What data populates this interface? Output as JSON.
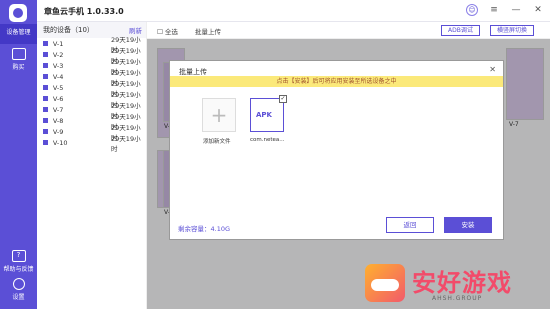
{
  "app": {
    "title": "章鱼云手机 1.0.33.0"
  },
  "nav": {
    "items": [
      {
        "label": "设备管理"
      },
      {
        "label": "购买"
      },
      {
        "label": "帮助与反馈"
      },
      {
        "label": "设置"
      }
    ]
  },
  "sidebar": {
    "title": "我的设备（10）",
    "refresh": "刷新",
    "devices": [
      {
        "name": "V-1",
        "time": "29天19小时"
      },
      {
        "name": "V-2",
        "time": "29天19小时"
      },
      {
        "name": "V-3",
        "time": "29天19小时"
      },
      {
        "name": "V-4",
        "time": "29天19小时"
      },
      {
        "name": "V-5",
        "time": "29天19小时"
      },
      {
        "name": "V-6",
        "time": "29天19小时"
      },
      {
        "name": "V-7",
        "time": "29天19小时"
      },
      {
        "name": "V-8",
        "time": "29天19小时"
      },
      {
        "name": "V-9",
        "time": "29天19小时"
      },
      {
        "name": "V-10",
        "time": "29天19小时"
      }
    ]
  },
  "toolbar": {
    "select_all": "全选",
    "batch_upload": "批量上传",
    "adb": "ADB调试",
    "switch_view": "横竖屏切换"
  },
  "screens": {
    "labels": [
      "V-7",
      "V-8",
      "V-9"
    ]
  },
  "modal": {
    "title": "批量上传",
    "close": "✕",
    "notice": "点击【安装】后可将应用安装至所选设备之中",
    "add_file": "添加新文件",
    "apk_badge": "APK",
    "apk_name": "com.netea...",
    "remaining": "剩余容量：4.10G",
    "back": "返回",
    "install": "安装"
  },
  "watermark": {
    "title": "安好游戏",
    "sub": "AHSH.GROUP"
  }
}
